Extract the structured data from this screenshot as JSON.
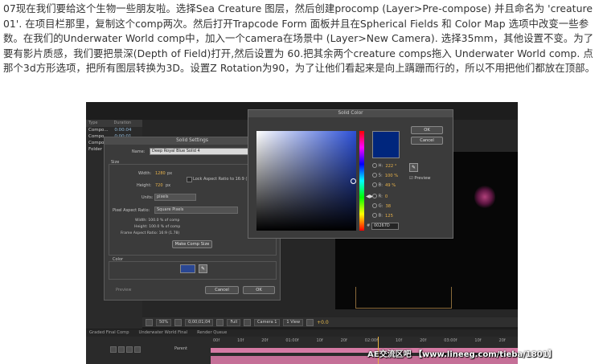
{
  "article": {
    "paragraph": "07现在我们要给这个生物一些朋友啦。选择Sea Creature 图层，然后创建procomp (Layer>Pre-compose) 并且命名为 'creature 01'. 在项目栏那里，复制这个comp两次。然后打开Trapcode Form 面板并且在Spherical Fields 和 Color Map 选项中改变一些参数。在我们的Underwater World comp中，加入一个camera在场景中 (Layer>New Camera). 选择35mm，其他设置不变。为了要有影片质感，我们要把景深(Depth of Field)打开,然后设置为 60.把其余两个creature comps拖入 Underwater World comp. 点那个3d方形选项，把所有图层转换为3D。设置Z Rotation为90，为了让他们看起来是向上蹒跚而行的，所以不用把他们都放在顶部。"
  },
  "project_panel": {
    "col_type": "Type",
    "col_duration": "Duration",
    "rows": [
      {
        "label": "Compo...",
        "duration": "0:00:04"
      },
      {
        "label": "Compo...",
        "duration": "0:00:01"
      },
      {
        "label": "Compo..."
      },
      {
        "label": "Folder"
      }
    ]
  },
  "solid_settings": {
    "title": "Solid Settings",
    "name_label": "Name:",
    "name_value": "Deep Royal Blue Solid 4",
    "size_label": "Size",
    "width_label": "Width:",
    "width_value": "1280",
    "height_label": "Height:",
    "height_value": "720",
    "px": "px",
    "units_label": "Units:",
    "units_value": "pixels",
    "lock_label": "Lock Aspect Ratio to 16:9 (1.78)",
    "par_label": "Pixel Aspect Ratio:",
    "par_value": "Square Pixels",
    "info_width": "Width: 100.0 % of comp",
    "info_height": "Height: 100.0 % of comp",
    "info_frame": "Frame Aspect Ratio: 16:9 (1.78)",
    "make_comp_size": "Make Comp Size",
    "color_label": "Color",
    "preview_label": "Preview",
    "cancel": "Cancel",
    "ok": "OK",
    "swatch_color": "#2a4793"
  },
  "solid_color": {
    "title": "Solid Color",
    "ok": "OK",
    "cancel": "Cancel",
    "preview_label": "Preview",
    "h_label": "H:",
    "h_value": "222 °",
    "s_label": "S:",
    "s_value": "100 %",
    "b_label": "B:",
    "b_value": "49 %",
    "r_label": "R:",
    "r_value": "0",
    "g_label": "G:",
    "g_value": "38",
    "blue_label": "B:",
    "blue_value": "125",
    "hex_prefix": "#",
    "hex_value": "00267D",
    "new_color": "#00267d"
  },
  "viewer_bar": {
    "zoom": "50%",
    "timecode": "0;00;01;04",
    "resolution": "Full",
    "camera": "Camera 1",
    "views": "1 View",
    "exposure": "+0.0"
  },
  "timeline": {
    "tabs": [
      "Graded Final Comp",
      "Underwater World Final",
      "Render Queue"
    ],
    "ruler": [
      "00f",
      "10f",
      "20f",
      "01:00f",
      "10f",
      "20f",
      "02:00f",
      "10f",
      "20f",
      "03:00f",
      "10f",
      "20f",
      "04"
    ],
    "parent_label": "Parent"
  },
  "watermark": {
    "site": "AE交流区吧",
    "url": "【www.lineeg.com/tieba/1801】"
  }
}
